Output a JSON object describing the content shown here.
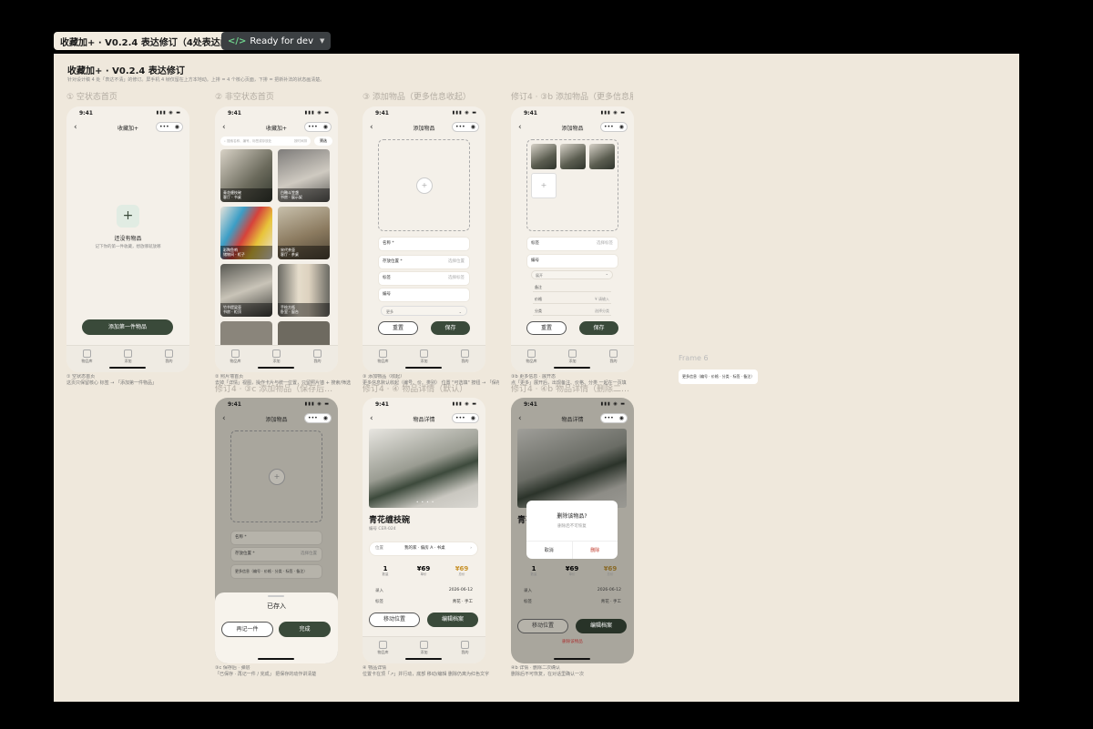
{
  "header": {
    "title": "收藏加+ · V0.2.4 表达修订（4处表达问题）",
    "status": "Ready for dev",
    "status_icon": "code-icon"
  },
  "canvas": {
    "title": "收藏加+ · V0.2.4 表达修订",
    "subtitle": "针对设计稿 4 处「表达不清」的修订。屏手机 4 帧仅留在上方本地动。上排 = 4 个核心页面，下排 = 把新补法的状态画清楚。"
  },
  "status_bar": {
    "time": "9:41",
    "icons": "▮▮▮ ◉ ▬"
  },
  "common": {
    "back": "‹",
    "capsule_dots": "•••",
    "capsule_dot": "◉",
    "tabs": [
      "物品库",
      "添加",
      "我的"
    ]
  },
  "frames": [
    {
      "label": "① 空状态首页",
      "nav": "收藏加+",
      "empty_title": "还没有物品",
      "empty_desc": "记下你的第一件收藏，想放哪就放哪",
      "cta": "添加第一件物品",
      "note": "① 空状态首页\n这页只保留核心 标签 → 「添加第一件物品」"
    },
    {
      "label": "② 非空状态首页",
      "nav": "收藏加+",
      "search": "搜索名称、编号、标签或存放处",
      "sort": "按时间排",
      "filter": "筛选",
      "cards": [
        {
          "name": "青花缠枝碗",
          "sub": "客厅 · 书桌"
        },
        {
          "name": "白釉斗笠盏",
          "sub": "书房 · 展示架"
        },
        {
          "name": "彩陶鱼哨",
          "sub": "储物间 · 柜子"
        },
        {
          "name": "宋代茶壶",
          "sub": "客厅 · 茶桌"
        },
        {
          "name": "竹节提梁壶",
          "sub": "书房 · 柜顶"
        },
        {
          "name": "手绘方瓶",
          "sub": "卧室 · 窗台"
        }
      ],
      "note": "② 照片墙首页\n去掉「详情」视图，操作卡片与统一位置，只留照片墙 + 搜索/筛选"
    },
    {
      "label": "③ 添加物品（更多信息收起）",
      "nav": "添加物品",
      "fields": [
        {
          "k": "名称 *",
          "v": ""
        },
        {
          "k": "存放位置 *",
          "v": "选择位置"
        },
        {
          "k": "标签",
          "v": "选择标签"
        },
        {
          "k": "编号",
          "v": ""
        }
      ],
      "more": "更多",
      "reset": "重置",
      "save": "保存",
      "note": "③ 添加物品（收起）\n更多信息默认收起（编号、价、类别） 位置 \"可选填\" 按钮 → 「保存」"
    },
    {
      "label": "修订4 · ③b 添加物品（更多信息展开）",
      "nav": "添加物品",
      "fields": [
        {
          "k": "标签",
          "v": "选择标签"
        },
        {
          "k": "编号",
          "v": ""
        }
      ],
      "more": "展开",
      "sub_fields": [
        {
          "k": "备注",
          "v": ""
        },
        {
          "k": "价格",
          "v": "¥ 请输入"
        },
        {
          "k": "分类",
          "v": "选择分类"
        }
      ],
      "reset": "重置",
      "save": "保存",
      "note": "③b 更多信息 · 展开态\n点「更多」展开后，出现备注、价格、分类 一起在一页填"
    },
    {
      "label": "修订4 · ③c 添加物品（保存后…",
      "nav": "添加物品",
      "fields": [
        {
          "k": "名称 *",
          "v": ""
        },
        {
          "k": "存放位置 *",
          "v": "选择位置"
        }
      ],
      "more_row": "更多信息（编号 · 价格 · 分类 · 标签 · 备注）",
      "sheet_title": "已存入",
      "again": "再记一件",
      "done": "完成",
      "note": "③c 保存后 · 弹层\n「已保存 · 再记一件 / 完成」 把保存的动作讲清楚"
    },
    {
      "label": "修订4 · ④ 物品详情（默认）",
      "nav": "物品详情",
      "item_title": "青花缠枝碗",
      "item_code": "编号 CER-024",
      "location_k": "位置",
      "location_v": "我的家 · 偏房 A · 书桌",
      "stats": [
        {
          "v": "1",
          "k": "数量"
        },
        {
          "v": "¥69",
          "k": "单价"
        },
        {
          "v": "¥69",
          "k": "总价"
        }
      ],
      "rows": [
        {
          "k": "录入",
          "v": "2026-06-12"
        },
        {
          "k": "标签",
          "v": "青花 · 手工"
        }
      ],
      "move": "移动位置",
      "edit": "编辑档案",
      "note": "④ 物品详情\n位置卡在顶「↗」并行动，底部 移动/编辑 删除仍离为红色文字"
    },
    {
      "label": "修订4 · ④b 物品详情（删除二…",
      "nav": "物品详情",
      "dialog_title": "删除该物品?",
      "dialog_desc": "删除后不可恢复",
      "cancel": "取消",
      "delete": "删除",
      "delete_link": "删除该物品",
      "note": "④b 详情 · 删除二次确认\n删除后不可恢复，在对话里确认一次"
    }
  ],
  "frame6": {
    "label": "Frame 6",
    "chip": "更多信息（编号 · 价格 · 分类 · 标签 · 备注）"
  },
  "colors": {
    "accent": "#3a4a3a",
    "danger": "#c0392b",
    "price": "#c8922a"
  }
}
